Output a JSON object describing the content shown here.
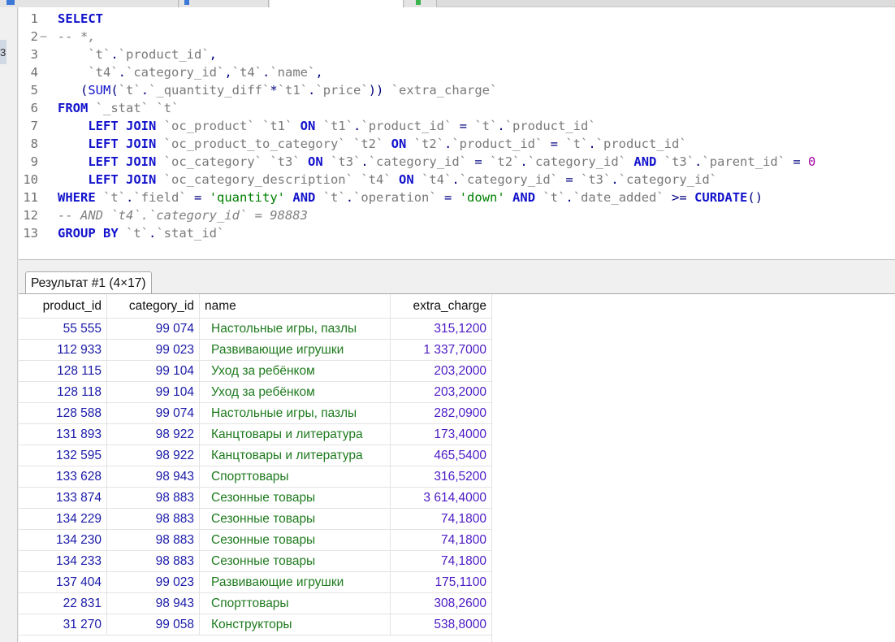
{
  "editor": {
    "lines": [
      {
        "n": "1",
        "fold": ""
      },
      {
        "n": "2",
        "fold": "−"
      },
      {
        "n": "3",
        "fold": ""
      },
      {
        "n": "4",
        "fold": ""
      },
      {
        "n": "5",
        "fold": ""
      },
      {
        "n": "6",
        "fold": ""
      },
      {
        "n": "7",
        "fold": ""
      },
      {
        "n": "8",
        "fold": ""
      },
      {
        "n": "9",
        "fold": ""
      },
      {
        "n": "10",
        "fold": ""
      },
      {
        "n": "11",
        "fold": ""
      },
      {
        "n": "12",
        "fold": ""
      },
      {
        "n": "13",
        "fold": ""
      }
    ],
    "sql": [
      [
        [
          "kw",
          "SELECT"
        ]
      ],
      [
        [
          "cm",
          "-- *,"
        ]
      ],
      [
        [
          "id",
          "    "
        ],
        [
          "bt",
          "`t`"
        ],
        [
          "op",
          "."
        ],
        [
          "bt",
          "`product_id`"
        ],
        [
          "op",
          ","
        ]
      ],
      [
        [
          "id",
          "    "
        ],
        [
          "bt",
          "`t4`"
        ],
        [
          "op",
          "."
        ],
        [
          "bt",
          "`category_id`"
        ],
        [
          "op",
          ","
        ],
        [
          "bt",
          "`t4`"
        ],
        [
          "op",
          "."
        ],
        [
          "bt",
          "`name`"
        ],
        [
          "op",
          ","
        ]
      ],
      [
        [
          "id",
          "   "
        ],
        [
          "op",
          "("
        ],
        [
          "fn",
          "SUM"
        ],
        [
          "op",
          "("
        ],
        [
          "bt",
          "`t`"
        ],
        [
          "op",
          "."
        ],
        [
          "bt",
          "`_quantity_diff`"
        ],
        [
          "op",
          "*"
        ],
        [
          "bt",
          "`t1`"
        ],
        [
          "op",
          "."
        ],
        [
          "bt",
          "`price`"
        ],
        [
          "op",
          "))"
        ],
        [
          "id",
          " "
        ],
        [
          "bt",
          "`extra_charge`"
        ]
      ],
      [
        [
          "kw",
          "FROM"
        ],
        [
          "id",
          " "
        ],
        [
          "bt",
          "`_stat`"
        ],
        [
          "id",
          " "
        ],
        [
          "bt",
          "`t`"
        ]
      ],
      [
        [
          "id",
          "    "
        ],
        [
          "kw",
          "LEFT JOIN"
        ],
        [
          "id",
          " "
        ],
        [
          "bt",
          "`oc_product`"
        ],
        [
          "id",
          " "
        ],
        [
          "bt",
          "`t1`"
        ],
        [
          "id",
          " "
        ],
        [
          "kw",
          "ON"
        ],
        [
          "id",
          " "
        ],
        [
          "bt",
          "`t1`"
        ],
        [
          "op",
          "."
        ],
        [
          "bt",
          "`product_id`"
        ],
        [
          "op",
          " = "
        ],
        [
          "bt",
          "`t`"
        ],
        [
          "op",
          "."
        ],
        [
          "bt",
          "`product_id`"
        ]
      ],
      [
        [
          "id",
          "    "
        ],
        [
          "kw",
          "LEFT JOIN"
        ],
        [
          "id",
          " "
        ],
        [
          "bt",
          "`oc_product_to_category`"
        ],
        [
          "id",
          " "
        ],
        [
          "bt",
          "`t2`"
        ],
        [
          "id",
          " "
        ],
        [
          "kw",
          "ON"
        ],
        [
          "id",
          " "
        ],
        [
          "bt",
          "`t2`"
        ],
        [
          "op",
          "."
        ],
        [
          "bt",
          "`product_id`"
        ],
        [
          "op",
          " = "
        ],
        [
          "bt",
          "`t`"
        ],
        [
          "op",
          "."
        ],
        [
          "bt",
          "`product_id`"
        ]
      ],
      [
        [
          "id",
          "    "
        ],
        [
          "kw",
          "LEFT JOIN"
        ],
        [
          "id",
          " "
        ],
        [
          "bt",
          "`oc_category`"
        ],
        [
          "id",
          " "
        ],
        [
          "bt",
          "`t3`"
        ],
        [
          "id",
          " "
        ],
        [
          "kw",
          "ON"
        ],
        [
          "id",
          " "
        ],
        [
          "bt",
          "`t3`"
        ],
        [
          "op",
          "."
        ],
        [
          "bt",
          "`category_id`"
        ],
        [
          "op",
          " = "
        ],
        [
          "bt",
          "`t2`"
        ],
        [
          "op",
          "."
        ],
        [
          "bt",
          "`category_id`"
        ],
        [
          "id",
          " "
        ],
        [
          "kw",
          "AND"
        ],
        [
          "id",
          " "
        ],
        [
          "bt",
          "`t3`"
        ],
        [
          "op",
          "."
        ],
        [
          "bt",
          "`parent_id`"
        ],
        [
          "op",
          " = "
        ],
        [
          "num",
          "0"
        ]
      ],
      [
        [
          "id",
          "    "
        ],
        [
          "kw",
          "LEFT JOIN"
        ],
        [
          "id",
          " "
        ],
        [
          "bt",
          "`oc_category_description`"
        ],
        [
          "id",
          " "
        ],
        [
          "bt",
          "`t4`"
        ],
        [
          "id",
          " "
        ],
        [
          "kw",
          "ON"
        ],
        [
          "id",
          " "
        ],
        [
          "bt",
          "`t4`"
        ],
        [
          "op",
          "."
        ],
        [
          "bt",
          "`category_id`"
        ],
        [
          "op",
          " = "
        ],
        [
          "bt",
          "`t3`"
        ],
        [
          "op",
          "."
        ],
        [
          "bt",
          "`category_id`"
        ]
      ],
      [
        [
          "kw",
          "WHERE"
        ],
        [
          "id",
          " "
        ],
        [
          "bt",
          "`t`"
        ],
        [
          "op",
          "."
        ],
        [
          "bt",
          "`field`"
        ],
        [
          "op",
          " = "
        ],
        [
          "str",
          "'quantity'"
        ],
        [
          "id",
          " "
        ],
        [
          "kw",
          "AND"
        ],
        [
          "id",
          " "
        ],
        [
          "bt",
          "`t`"
        ],
        [
          "op",
          "."
        ],
        [
          "bt",
          "`operation`"
        ],
        [
          "op",
          " = "
        ],
        [
          "str",
          "'down'"
        ],
        [
          "id",
          " "
        ],
        [
          "kw",
          "AND"
        ],
        [
          "id",
          " "
        ],
        [
          "bt",
          "`t`"
        ],
        [
          "op",
          "."
        ],
        [
          "bt",
          "`date_added`"
        ],
        [
          "op",
          " >= "
        ],
        [
          "kw",
          "CURDATE"
        ],
        [
          "op",
          "()"
        ]
      ],
      [
        [
          "cm",
          "-- AND `t4`.`category_id` = 98883"
        ]
      ],
      [
        [
          "kw",
          "GROUP BY"
        ],
        [
          "id",
          " "
        ],
        [
          "bt",
          "`t`"
        ],
        [
          "op",
          "."
        ],
        [
          "bt",
          "`stat_id`"
        ]
      ]
    ]
  },
  "sidebar_fragment": "3",
  "result": {
    "tab_label": "Результат #1 (4×17)",
    "columns": [
      "product_id",
      "category_id",
      "name",
      "extra_charge"
    ],
    "rows": [
      [
        "55 555",
        "99 074",
        "Настольные игры, пазлы",
        "315,1200"
      ],
      [
        "112 933",
        "99 023",
        "Развивающие игрушки",
        "1 337,7000"
      ],
      [
        "128 115",
        "99 104",
        "Уход за ребёнком",
        "203,2000"
      ],
      [
        "128 118",
        "99 104",
        "Уход за ребёнком",
        "203,2000"
      ],
      [
        "128 588",
        "99 074",
        "Настольные игры, пазлы",
        "282,0900"
      ],
      [
        "131 893",
        "98 922",
        "Канцтовары и литература",
        "173,4000"
      ],
      [
        "132 595",
        "98 922",
        "Канцтовары и литература",
        "465,5400"
      ],
      [
        "133 628",
        "98 943",
        "Спорттовары",
        "316,5200"
      ],
      [
        "133 874",
        "98 883",
        "Сезонные товары",
        "3 614,4000"
      ],
      [
        "134 229",
        "98 883",
        "Сезонные товары",
        "74,1800"
      ],
      [
        "134 230",
        "98 883",
        "Сезонные товары",
        "74,1800"
      ],
      [
        "134 233",
        "98 883",
        "Сезонные товары",
        "74,1800"
      ],
      [
        "137 404",
        "99 023",
        "Развивающие игрушки",
        "175,1100"
      ],
      [
        "22 831",
        "98 943",
        "Спорттовары",
        "308,2600"
      ],
      [
        "31 270",
        "99 058",
        "Конструкторы",
        "538,8000"
      ]
    ]
  }
}
